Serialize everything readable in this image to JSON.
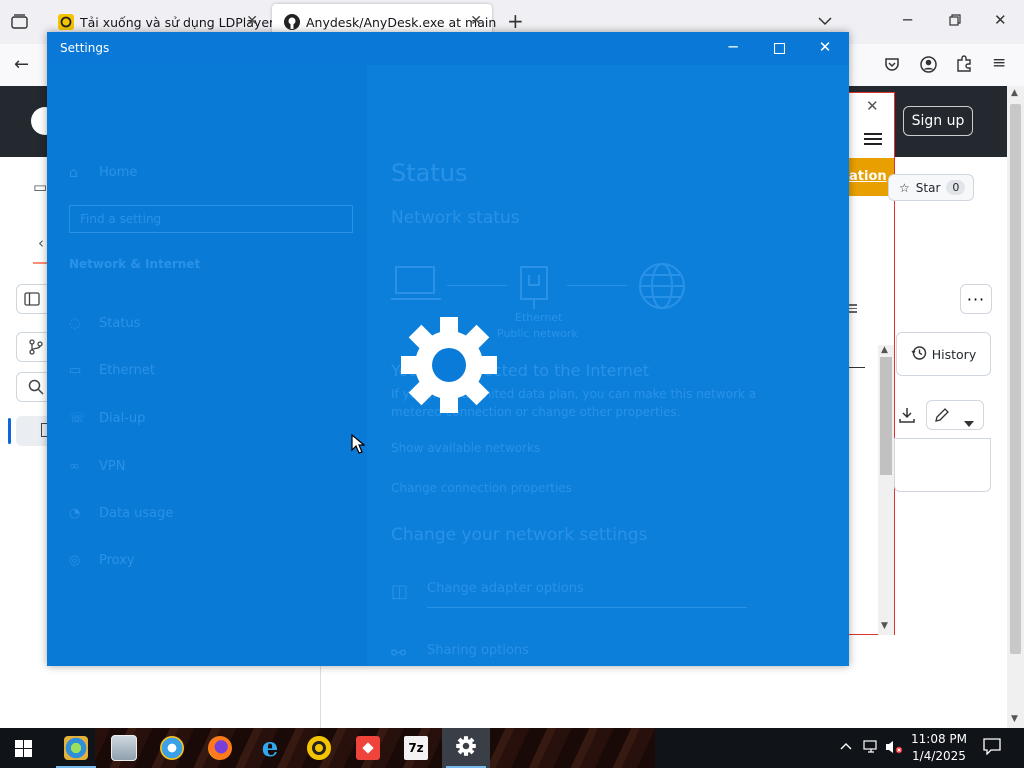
{
  "browser": {
    "tabs": [
      {
        "title": "Tải xuống và sử dụng LDPlayer",
        "icon": "ldplayer-icon"
      },
      {
        "title": "Anydesk/AnyDesk.exe at main",
        "icon": "github-icon"
      }
    ],
    "new_tab_symbol": "+",
    "list_tabs_symbol": "⌄"
  },
  "github": {
    "signup_label": "Sign up",
    "promo_label": "ation",
    "star_label": "Star",
    "star_count": "0",
    "history_label": "History",
    "more_label": "···"
  },
  "settings": {
    "window_title": "Settings",
    "ghost": {
      "home": "Home",
      "search_placeholder": "Find a setting",
      "category": "Network & Internet",
      "nav": [
        "Status",
        "Ethernet",
        "Dial-up",
        "VPN",
        "Proxy",
        "Data usage"
      ],
      "page_title": "Status",
      "network_status": "Network status",
      "ethernet_label": "Ethernet",
      "network_label": "Public network",
      "connected": "You're connected to the Internet",
      "connected_detail_1": "If you have a limited data plan, you can make this network a",
      "connected_detail_2": "metered connection or change other properties.",
      "link_1": "Show available networks",
      "link_2": "Change connection properties",
      "change_title": "Change your network settings",
      "adapter": "Change adapter options",
      "sharing": "Sharing options"
    }
  },
  "taskbar": {
    "clock_time": "11:08 PM",
    "clock_date": "1/4/2025",
    "items": [
      "file-manager-icon",
      "computer-icon",
      "internet-explorer-icon",
      "firefox-icon",
      "edge-icon",
      "ldplayer-icon",
      "anydesk-icon",
      "7zip-icon",
      "settings-icon"
    ],
    "sevenzip_label": "7z"
  },
  "colors": {
    "settings_bg": "#0a7bd8",
    "ghost_text": "#2a92e6",
    "github_header": "#24292f",
    "promo_orange": "#e8a000"
  }
}
